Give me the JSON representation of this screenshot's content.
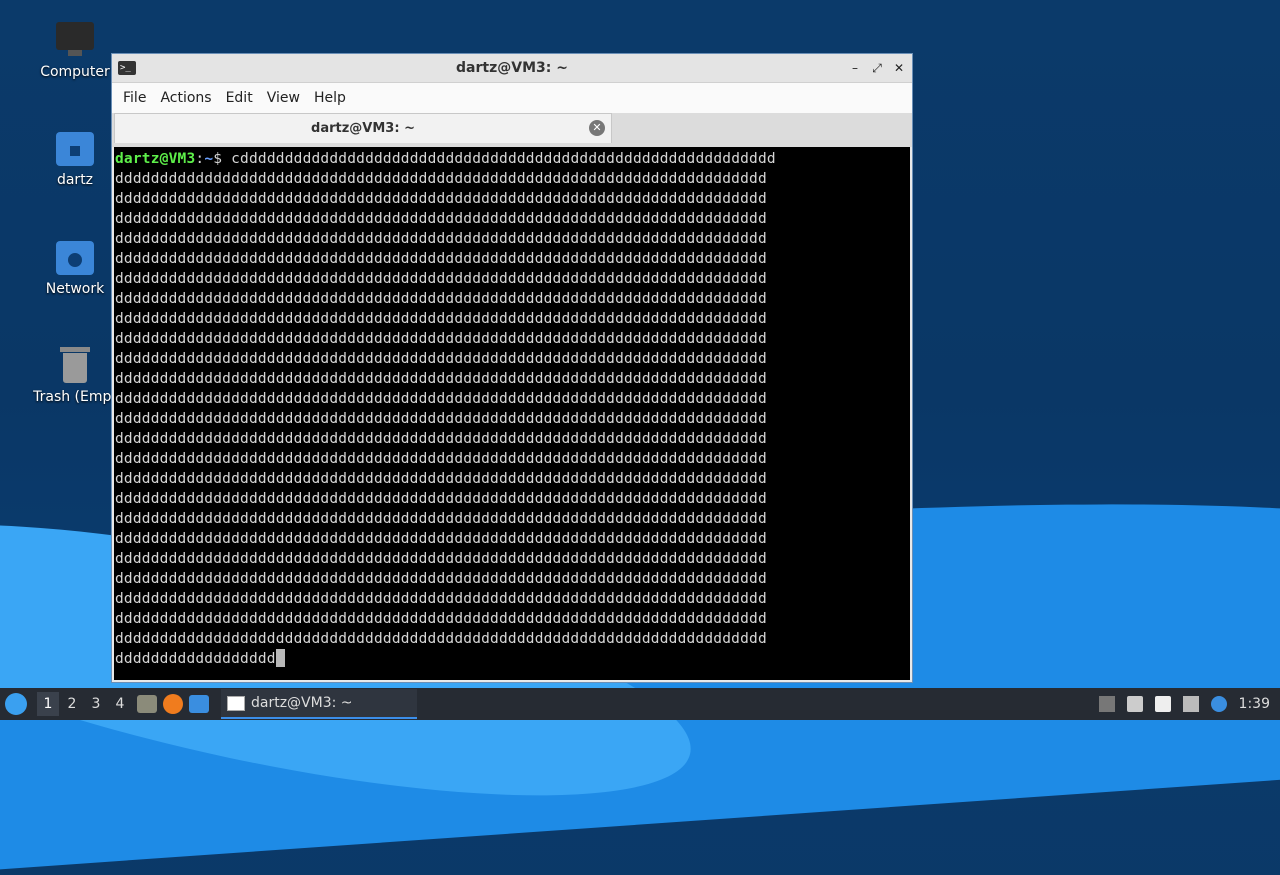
{
  "desktop": {
    "icons": [
      {
        "label": "Computer"
      },
      {
        "label": "dartz"
      },
      {
        "label": "Network"
      },
      {
        "label": "Trash (Empt"
      }
    ]
  },
  "window": {
    "title": "dartz@VM3: ~",
    "controls": {
      "minimize": "–",
      "maximize": "⤢",
      "close": "✕"
    },
    "menu": [
      "File",
      "Actions",
      "Edit",
      "View",
      "Help"
    ],
    "tab": {
      "label": "dartz@VM3: ~",
      "close": "✕"
    }
  },
  "terminal": {
    "prompt_user": "dartz@VM3",
    "prompt_sep": ":",
    "prompt_path": "~",
    "prompt_symbol": "$ ",
    "first_line_input": "cdddddddddddddddddddddddddddddddddddddddddddddddddddddddddddd",
    "full_line": "ddddddddddddddddddddddddddddddddddddddddddddddddddddddddddddddddddddddddd",
    "full_line_count": 24,
    "last_line": "dddddddddddddddddd"
  },
  "taskbar": {
    "workspaces": [
      "1",
      "2",
      "3",
      "4"
    ],
    "active_workspace": "1",
    "task_label": "dartz@VM3: ~",
    "clock": "1:39"
  }
}
